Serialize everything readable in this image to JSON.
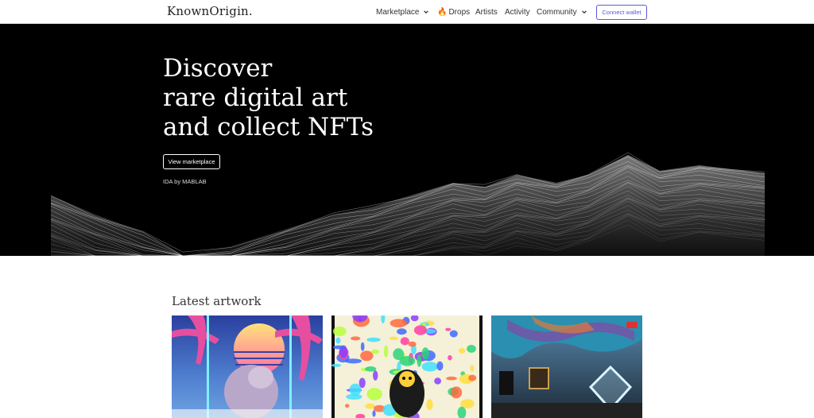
{
  "brand": {
    "logo_text": "KnownOrigin."
  },
  "nav": {
    "marketplace": "Marketplace",
    "drops": "Drops",
    "artists": "Artists",
    "activity": "Activity",
    "community": "Community",
    "connect_wallet": "Connect wallet"
  },
  "hero": {
    "title_lines": [
      "Discover",
      "rare digital art",
      "and collect NFTs"
    ],
    "cta": "View marketplace",
    "credit": "IDA by MABLAB"
  },
  "latest": {
    "title": "Latest artwork",
    "cards": [
      {
        "theme": "synthwave-lion"
      },
      {
        "theme": "psychedelic-figure"
      },
      {
        "theme": "neon-room-diamond"
      }
    ]
  },
  "colors": {
    "accent": "#5b5bd6",
    "hero_bg": "#000000",
    "text": "#333333"
  }
}
